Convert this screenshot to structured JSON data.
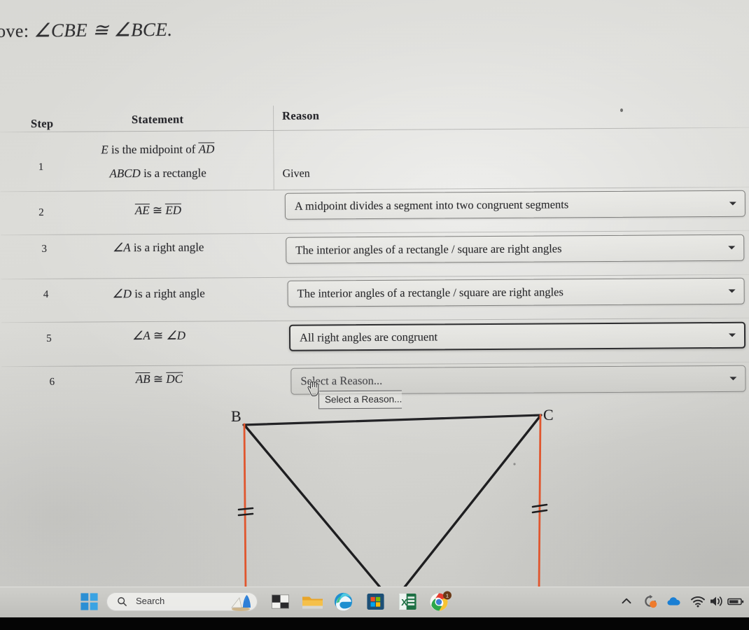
{
  "document": {
    "prove_prefix": "rove:",
    "prove_statement": "∠CBE ≅ ∠BCE."
  },
  "table": {
    "headers": {
      "step": "Step",
      "statement": "Statement",
      "reason": "Reason"
    },
    "rows": [
      {
        "step": "1",
        "statement_line1_pre": "E",
        "statement_line1_mid": " is the midpoint of ",
        "statement_line1_seg": "AD",
        "statement_line2_pre": "ABCD",
        "statement_line2_post": " is a rectangle",
        "reason_type": "static",
        "reason_text": "Given"
      },
      {
        "step": "2",
        "statement_seg1": "AE",
        "statement_rel": " ≅ ",
        "statement_seg2": "ED",
        "reason_type": "dropdown",
        "reason_text": "A midpoint divides a segment into two congruent segments",
        "reason_state": "selected"
      },
      {
        "step": "3",
        "statement_angle": "∠A",
        "statement_post": " is a right angle",
        "reason_type": "dropdown",
        "reason_text": "The interior angles of a rectangle / square are right angles",
        "reason_state": "selected"
      },
      {
        "step": "4",
        "statement_angle": "∠D",
        "statement_post": " is a right angle",
        "reason_type": "dropdown",
        "reason_text": "The interior angles of a rectangle / square are right angles",
        "reason_state": "selected"
      },
      {
        "step": "5",
        "statement_angle": "∠A",
        "statement_rel": " ≅ ",
        "statement_angle2": "∠D",
        "reason_type": "dropdown",
        "reason_text": "All right angles are congruent",
        "reason_state": "focused"
      },
      {
        "step": "6",
        "statement_seg1": "AB",
        "statement_rel": " ≅ ",
        "statement_seg2": "DC",
        "reason_type": "dropdown",
        "reason_text": "Select a Reason...",
        "reason_state": "open-placeholder"
      }
    ]
  },
  "dropdown_popup": {
    "options": [
      "Select a Reason..."
    ]
  },
  "figure": {
    "label_b": "B",
    "label_c": "C",
    "line_color_vertical": "#e0562e",
    "line_color_diagonal": "#1e1e20",
    "tick_marks": "double"
  },
  "taskbar": {
    "search_label": "Search",
    "icons": [
      {
        "name": "start-icon",
        "label": "Start"
      },
      {
        "name": "search-icon",
        "label": "Search"
      },
      {
        "name": "widgets-weather-icon",
        "label": "Widgets"
      },
      {
        "name": "file-explorer-icon",
        "label": "File Explorer"
      },
      {
        "name": "folder-icon",
        "label": "Folder"
      },
      {
        "name": "edge-icon",
        "label": "Microsoft Edge"
      },
      {
        "name": "microsoft-store-icon",
        "label": "Microsoft Store"
      },
      {
        "name": "excel-icon",
        "label": "Excel"
      },
      {
        "name": "chrome-icon",
        "label": "Google Chrome"
      }
    ],
    "tray": [
      {
        "name": "show-hidden-icons-chevron",
        "label": "Show hidden icons"
      },
      {
        "name": "sync-icon",
        "label": "Sync"
      },
      {
        "name": "onedrive-cloud-icon",
        "label": "OneDrive"
      },
      {
        "name": "wifi-icon",
        "label": "Network"
      },
      {
        "name": "volume-icon",
        "label": "Volume"
      },
      {
        "name": "battery-icon",
        "label": "Battery"
      }
    ],
    "chrome_badge": "1"
  },
  "colors": {
    "accent_orange": "#e0562e",
    "ink": "#26262a",
    "paper": "#d8d8d4",
    "taskbar": "#c6c6c2"
  }
}
